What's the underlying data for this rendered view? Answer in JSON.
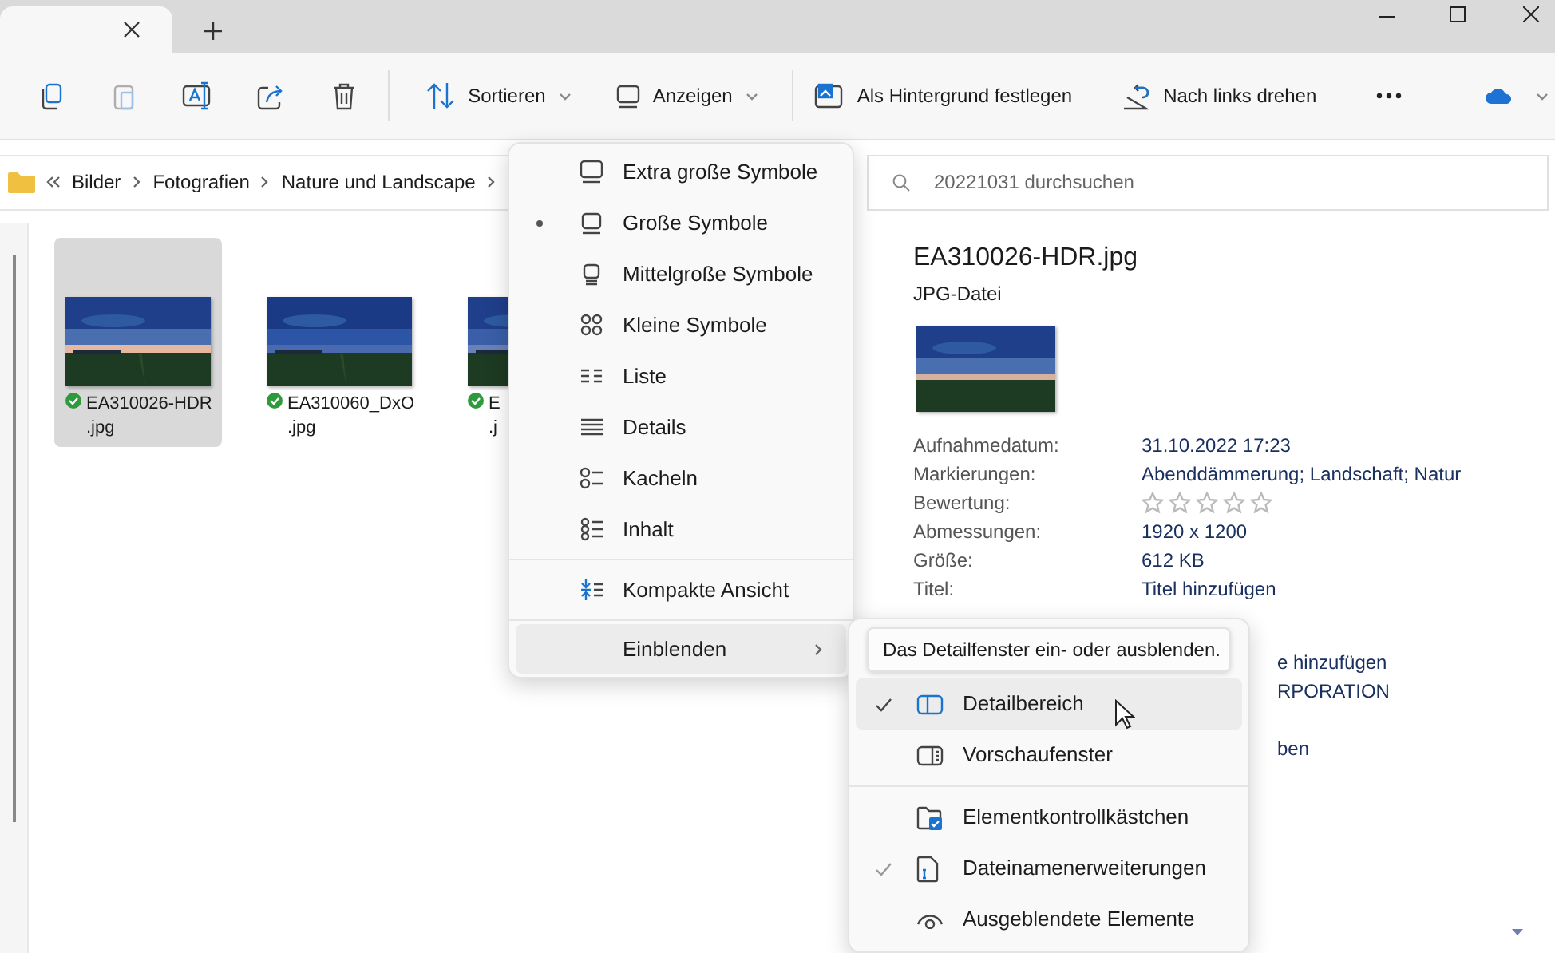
{
  "tab": {
    "active": true
  },
  "toolbar": {
    "items": [
      {
        "kind": "icon",
        "disabled": false
      },
      {
        "kind": "icon",
        "disabled": true
      },
      {
        "kind": "icon",
        "disabled": false
      },
      {
        "kind": "icon",
        "disabled": false
      },
      {
        "kind": "icon",
        "disabled": false
      },
      {
        "kind": "dropdown",
        "label": "Sortieren"
      },
      {
        "kind": "dropdown",
        "label": "Anzeigen"
      },
      {
        "kind": "button",
        "label": "Als Hintergrund festlegen"
      },
      {
        "kind": "button",
        "label": "Nach links drehen"
      },
      {
        "kind": "more"
      },
      {
        "kind": "cloud"
      }
    ]
  },
  "breadcrumb": [
    "Bilder",
    "Fotografien",
    "Nature und Landscape"
  ],
  "search": {
    "placeholder": "20221031 durchsuchen"
  },
  "files": [
    {
      "lines": [
        "EA310026-HDR",
        ".jpg"
      ],
      "selected": true,
      "synced": true
    },
    {
      "lines": [
        "EA310060_DxO",
        ".jpg"
      ],
      "selected": false,
      "synced": true
    },
    {
      "lines": [
        "E",
        ".j"
      ],
      "selected": false,
      "synced": true
    }
  ],
  "view_menu": [
    {
      "kind": "option",
      "label": "Extra große Symbole",
      "selected": false
    },
    {
      "kind": "option",
      "label": "Große Symbole",
      "selected": true
    },
    {
      "kind": "option",
      "label": "Mittelgroße Symbole",
      "selected": false
    },
    {
      "kind": "option",
      "label": "Kleine Symbole",
      "selected": false
    },
    {
      "kind": "option",
      "label": "Liste",
      "selected": false
    },
    {
      "kind": "option",
      "label": "Details",
      "selected": false
    },
    {
      "kind": "option",
      "label": "Kacheln",
      "selected": false
    },
    {
      "kind": "option",
      "label": "Inhalt",
      "selected": false
    },
    {
      "kind": "toggle",
      "label": "Kompakte Ansicht",
      "checked": false
    },
    {
      "kind": "submenu",
      "label": "Einblenden",
      "expanded": true
    }
  ],
  "show_menu": {
    "tooltip": "Das Detailfenster ein- oder ausblenden.",
    "items": [
      {
        "label": "Detailbereich",
        "checked": true,
        "hovered": true
      },
      {
        "label": "Vorschaufenster",
        "checked": false,
        "hovered": false
      },
      {
        "label": "Elementkontrollkästchen",
        "checked": false,
        "hovered": false
      },
      {
        "label": "Dateinamenerweiterungen",
        "checked": true,
        "hovered": false
      },
      {
        "label": "Ausgeblendete Elemente",
        "checked": false,
        "hovered": false
      }
    ]
  },
  "details": {
    "title": "EA310026-HDR.jpg",
    "type": "JPG-Datei",
    "properties": [
      {
        "kind": "text",
        "label": "Aufnahmedatum:",
        "value": "31.10.2022 17:23"
      },
      {
        "kind": "text",
        "label": "Markierungen:",
        "value": "Abenddämmerung; Landschaft; Natur"
      },
      {
        "kind": "stars",
        "label": "Bewertung:",
        "stars": 0
      },
      {
        "kind": "text",
        "label": "Abmessungen:",
        "value": "1920 x 1200"
      },
      {
        "kind": "text",
        "label": "Größe:",
        "value": "612 KB"
      },
      {
        "kind": "text",
        "label": "Titel:",
        "value": "Titel hinzufügen"
      }
    ],
    "covered": [
      "e hinzufügen",
      "RPORATION",
      "ben"
    ]
  }
}
